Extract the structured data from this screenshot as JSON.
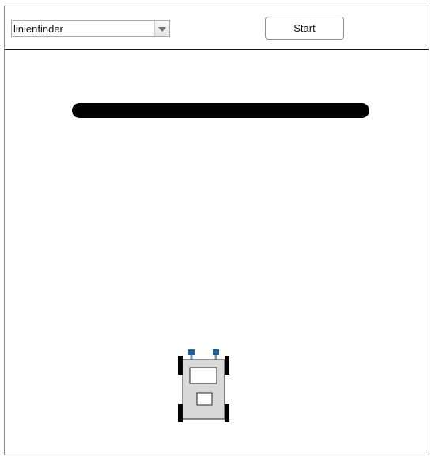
{
  "toolbar": {
    "mode_select": {
      "value": "linienfinder"
    },
    "start_label": "Start"
  },
  "scene": {
    "line_color": "#000000",
    "robot": {
      "body_color": "#d9d9d9",
      "wheel_color": "#000000",
      "sensor_color": "#1f5f9e",
      "outline_color": "#222222"
    }
  },
  "icons": {
    "dropdown": "chevron-down-icon",
    "robot": "robot-icon"
  }
}
